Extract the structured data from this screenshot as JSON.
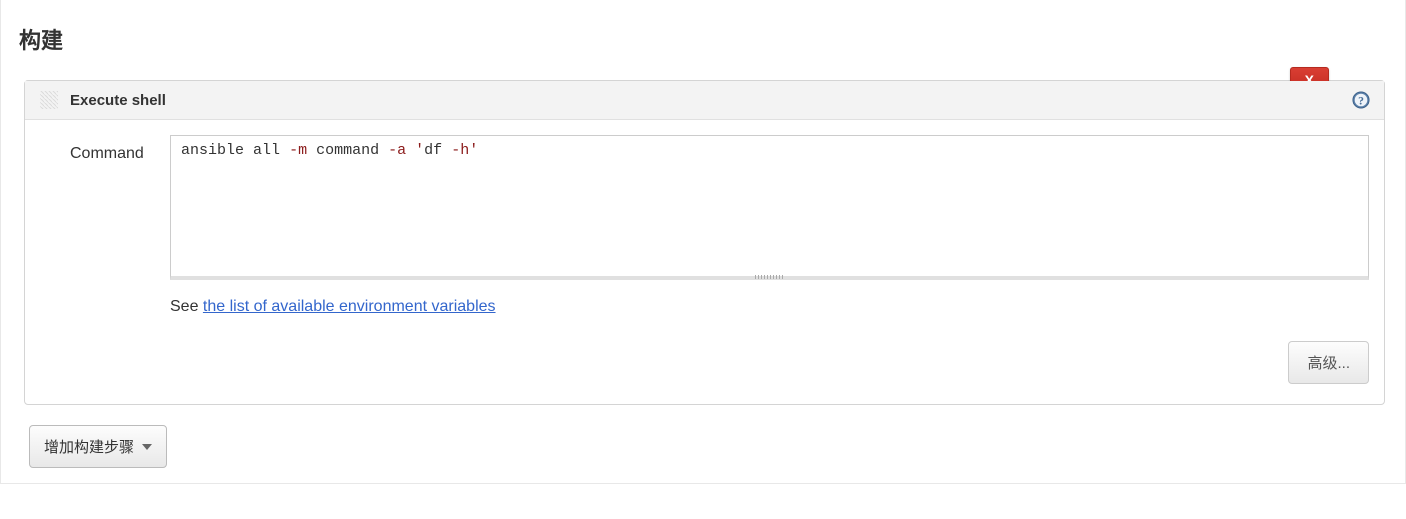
{
  "section": {
    "title": "构建"
  },
  "build_step": {
    "header_title": "Execute shell",
    "delete_label": "X",
    "command_label": "Command",
    "command_tokens": {
      "t1": "ansible",
      "t2": "all",
      "t3": "-m",
      "t4": "command",
      "t5": "-a",
      "t6": "'",
      "t7": "df",
      "t8": "-h",
      "t9": "'"
    },
    "help_prefix": "See ",
    "help_link_text": "the list of available environment variables",
    "advanced_label": "高级..."
  },
  "add_step": {
    "label": "增加构建步骤"
  }
}
